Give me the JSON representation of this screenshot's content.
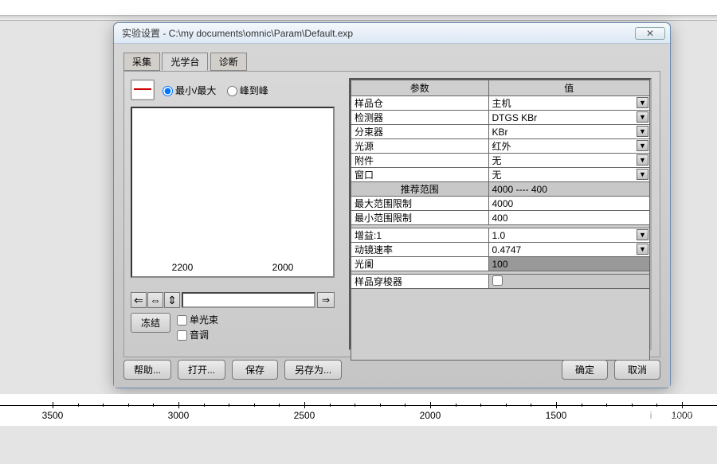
{
  "window": {
    "title_prefix": "实验设置 - ",
    "path": "C:\\my documents\\omnic\\Param\\Default.exp",
    "close_glyph": "✕"
  },
  "tabs": {
    "collect": "采集",
    "optical": "光学台",
    "diagnose": "诊断",
    "active": "optical"
  },
  "radio": {
    "minmax": "最小/最大",
    "p2p": "峰到峰"
  },
  "preview": {
    "xticks": [
      "2200",
      "2000"
    ]
  },
  "arrows": {
    "left_glyphs": [
      "⇐",
      "⇔",
      "⇕"
    ],
    "right_glyph": "⇒"
  },
  "freeze_label": "冻结",
  "checks": {
    "single_beam": "单光束",
    "tone": "音调"
  },
  "param_header": {
    "param": "参数",
    "value": "值"
  },
  "rows": [
    {
      "label": "样品仓",
      "value": "主机",
      "dd": true
    },
    {
      "label": "检测器",
      "value": "DTGS KBr",
      "dd": true
    },
    {
      "label": "分束器",
      "value": "KBr",
      "dd": true
    },
    {
      "label": "光源",
      "value": "红外",
      "dd": true
    },
    {
      "label": "附件",
      "value": "无",
      "dd": true
    },
    {
      "label": "窗口",
      "value": "无",
      "dd": true
    }
  ],
  "range_header": "推荐范围",
  "range_value": "4000 ---- 400",
  "range_rows": [
    {
      "label": "最大范围限制",
      "value": "4000"
    },
    {
      "label": "最小范围限制",
      "value": "400"
    }
  ],
  "gain_rows": [
    {
      "label": "增益:1",
      "value": "1.0",
      "dd": true
    },
    {
      "label": "动镜速率",
      "value": "0.4747",
      "dd": true
    },
    {
      "label": "光阑",
      "value": "100",
      "dark": true
    }
  ],
  "shuttle": {
    "label": "样品穿梭器",
    "checked": false
  },
  "buttons": {
    "help": "帮助...",
    "open": "打开...",
    "save": "保存",
    "saveas": "另存为...",
    "ok": "确定",
    "cancel": "取消"
  },
  "ruler": {
    "labels": [
      "3500",
      "3000",
      "2500",
      "2000",
      "1500",
      "1000"
    ]
  },
  "watermark": "仪器信息网"
}
